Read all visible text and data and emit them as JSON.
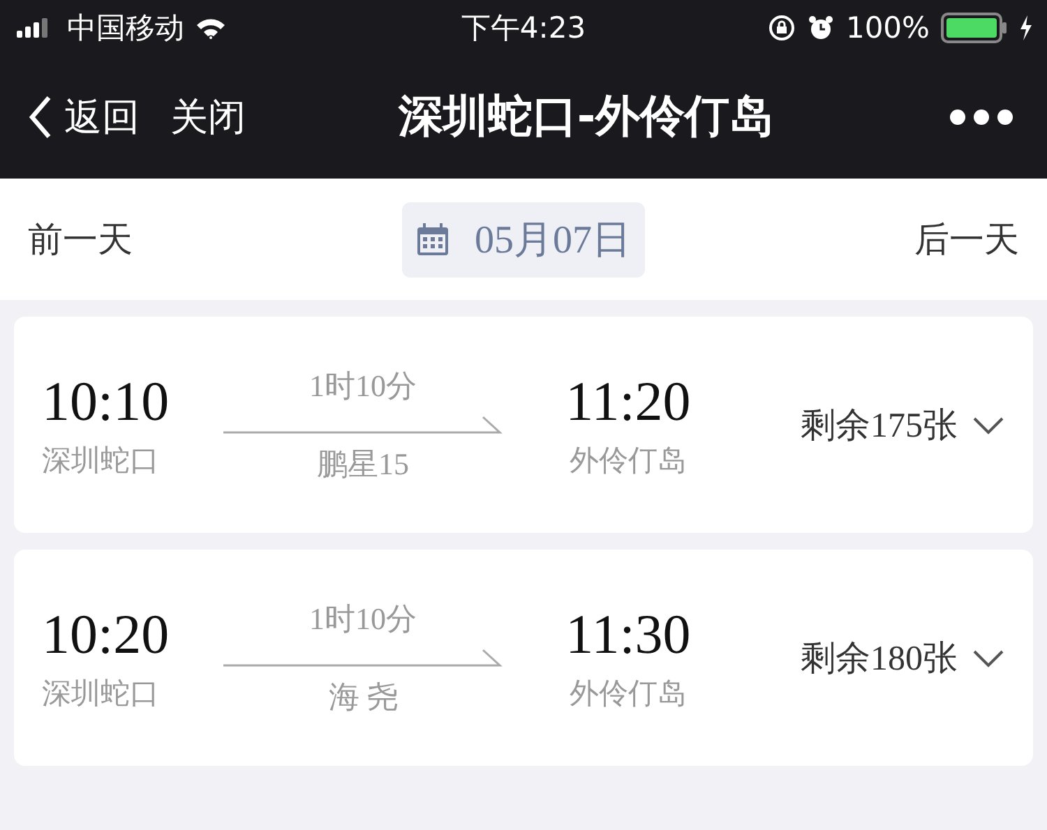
{
  "status_bar": {
    "carrier": "中国移动",
    "time": "下午4:23",
    "battery": "100%"
  },
  "nav": {
    "back": "返回",
    "close": "关闭",
    "title": "深圳蛇口-外伶仃岛"
  },
  "date_bar": {
    "previous": "前一天",
    "date": "05月07日",
    "next": "后一天"
  },
  "trips": [
    {
      "depart_time": "10:10",
      "depart_port": "深圳蛇口",
      "duration": "1时10分",
      "vessel": "鹏星15",
      "arrive_time": "11:20",
      "arrive_port": "外伶仃岛",
      "remaining": "剩余175张"
    },
    {
      "depart_time": "10:20",
      "depart_port": "深圳蛇口",
      "duration": "1时10分",
      "vessel": "海 尧",
      "arrive_time": "11:30",
      "arrive_port": "外伶仃岛",
      "remaining": "剩余180张"
    }
  ]
}
